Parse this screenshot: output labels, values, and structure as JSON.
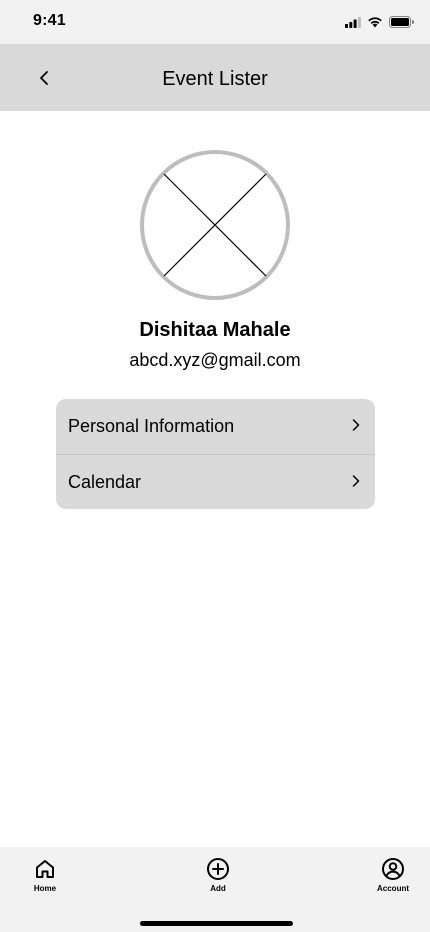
{
  "status_bar": {
    "time": "9:41",
    "icons": [
      "signal-icon",
      "wifi-icon",
      "battery-icon"
    ]
  },
  "header": {
    "title": "Event Lister",
    "back_icon": "chevron-left-icon"
  },
  "profile": {
    "avatar": "image-placeholder-icon",
    "name": "Dishitaa Mahale",
    "email": "abcd.xyz@gmail.com"
  },
  "menu": {
    "items": [
      {
        "label": "Personal Information",
        "icon": "chevron-right-icon"
      },
      {
        "label": "Calendar",
        "icon": "chevron-right-icon"
      }
    ]
  },
  "tab_bar": {
    "tabs": [
      {
        "label": "Home",
        "icon": "home-icon"
      },
      {
        "label": "Add",
        "icon": "add-circle-icon"
      },
      {
        "label": "Account",
        "icon": "account-icon"
      }
    ]
  },
  "colors": {
    "bar_background": "#f2f2f2",
    "header_background": "#d9d9d9",
    "card_background": "#d9d9d9",
    "avatar_ring": "#bdbdbd"
  }
}
